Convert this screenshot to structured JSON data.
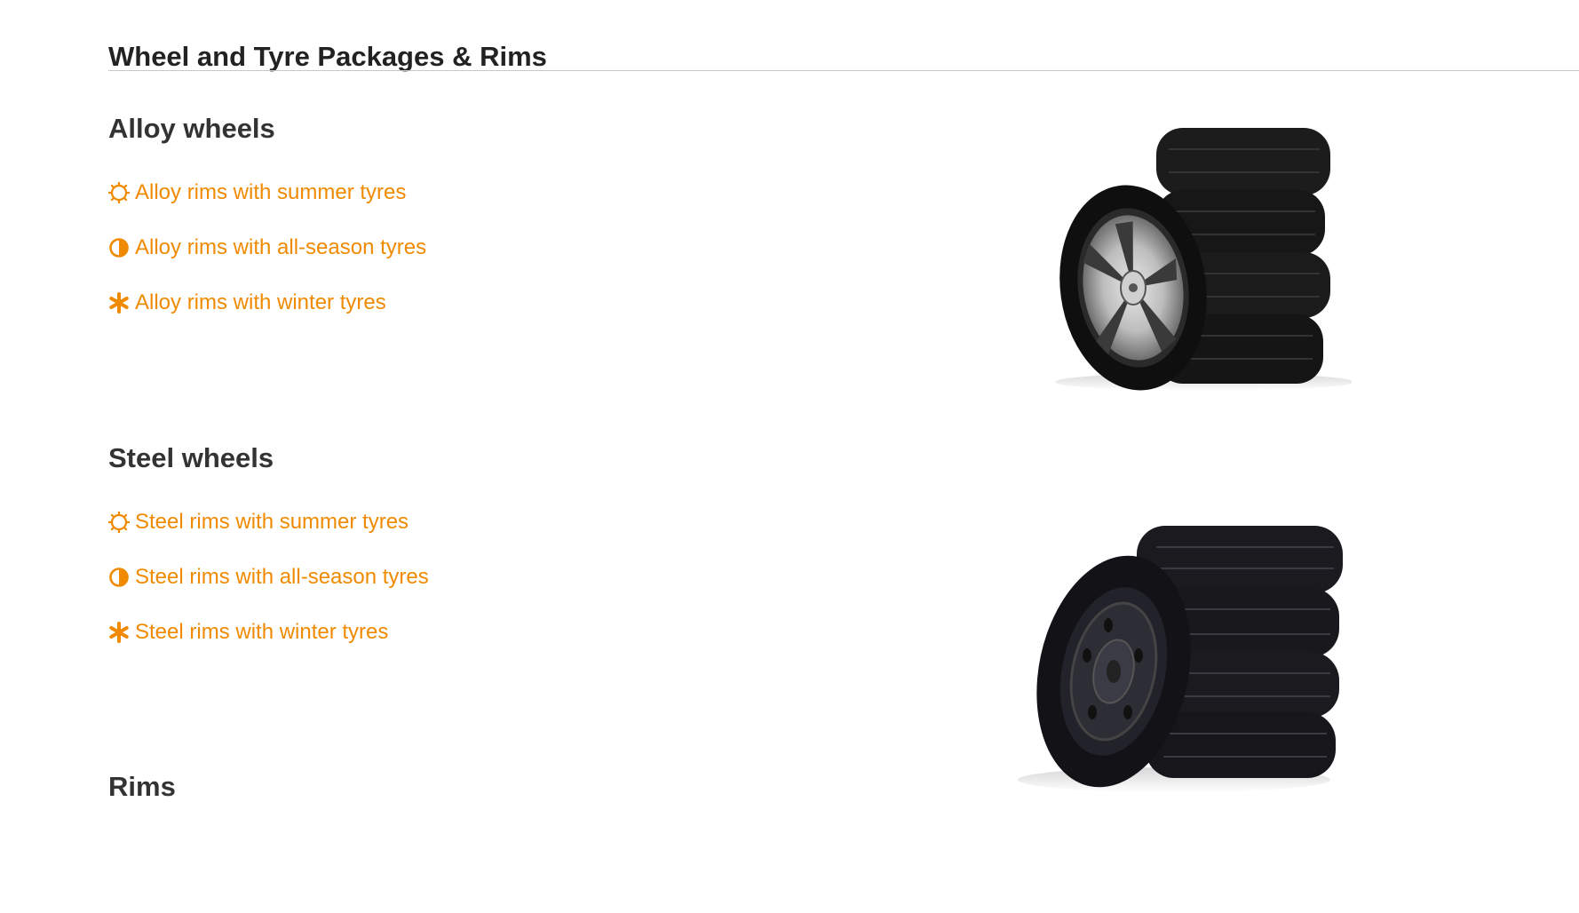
{
  "page": {
    "title": "Wheel and Tyre Packages & Rims"
  },
  "sections": [
    {
      "heading": "Alloy wheels",
      "options": [
        {
          "icon": "sun-icon",
          "label": "Alloy rims with summer tyres"
        },
        {
          "icon": "half-circle-icon",
          "label": "Alloy rims with all-season tyres"
        },
        {
          "icon": "snowflake-asterisk-icon",
          "label": "Alloy rims with winter tyres"
        }
      ],
      "image": "alloy-wheel-tyre-stack"
    },
    {
      "heading": "Steel wheels",
      "options": [
        {
          "icon": "sun-icon",
          "label": "Steel rims with summer tyres"
        },
        {
          "icon": "half-circle-icon",
          "label": "Steel rims with all-season tyres"
        },
        {
          "icon": "snowflake-asterisk-icon",
          "label": "Steel rims with winter tyres"
        }
      ],
      "image": "steel-wheel-tyre-stack"
    },
    {
      "heading": "Rims"
    }
  ],
  "colors": {
    "accent": "#f08a00",
    "heading": "#333333",
    "rule": "#c8c8c8"
  }
}
